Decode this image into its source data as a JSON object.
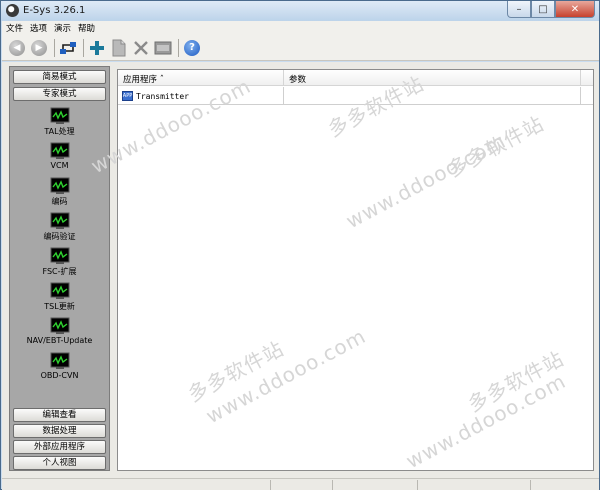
{
  "window": {
    "title": "E-Sys 3.26.1"
  },
  "titlebar_buttons": {
    "minimize": "–",
    "maximize": "□",
    "close": "✕"
  },
  "menu": [
    "文件",
    "选项",
    "演示",
    "帮助"
  ],
  "toolbar": {
    "icons": [
      "back-icon",
      "forward-icon",
      "connect-icon",
      "add-icon",
      "new-document-icon",
      "delete-icon",
      "properties-icon",
      "help-icon"
    ],
    "back_glyph": "◀",
    "forward_glyph": "▶",
    "help_glyph": "?"
  },
  "sidebar": {
    "top_buttons": [
      "简易模式",
      "专家模式"
    ],
    "tools": [
      "TAL处理",
      "VCM",
      "编码",
      "编码验证",
      "FSC-扩展",
      "TSL更新",
      "NAV/EBT-Update",
      "OBD-CVN"
    ],
    "bottom_buttons": [
      "编辑查看",
      "数据处理",
      "外部应用程序",
      "个人视图"
    ]
  },
  "table": {
    "columns": [
      "应用程序 ˆ",
      "参数"
    ],
    "rows": [
      {
        "icon_text": "APP",
        "application": "Transmitter",
        "parameters": ""
      }
    ]
  },
  "watermarks": [
    "www.ddooo.com",
    "多多软件站",
    "www.ddooo.com",
    "多多软件站",
    "www.ddooo.com",
    "多多软件站",
    "www.ddooo.com",
    "多多软件站"
  ]
}
